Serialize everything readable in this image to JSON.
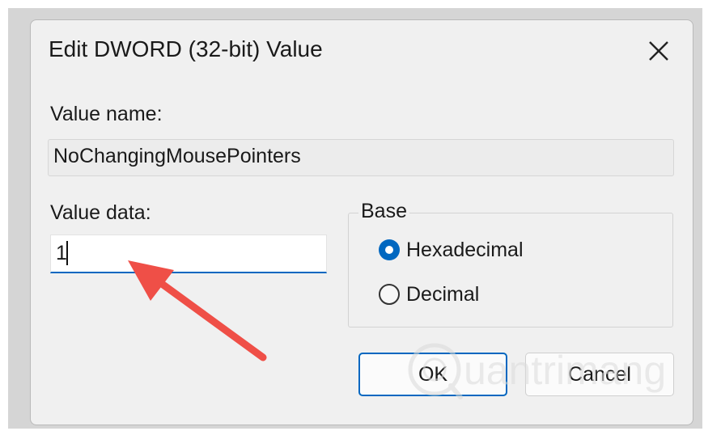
{
  "dialog": {
    "title": "Edit DWORD (32-bit) Value",
    "value_name_label": "Value name:",
    "value_name": "NoChangingMousePointers",
    "value_data_label": "Value data:",
    "value_data": "1",
    "base": {
      "legend": "Base",
      "options": [
        {
          "label": "Hexadecimal",
          "selected": true
        },
        {
          "label": "Decimal",
          "selected": false
        }
      ]
    },
    "ok_label": "OK",
    "cancel_label": "Cancel"
  },
  "annotation": {
    "arrow_color": "#ef4f47"
  },
  "colors": {
    "accent": "#0067c0",
    "dialog_bg": "#f0f0f0"
  },
  "watermark": {
    "text": "uantrimang"
  }
}
